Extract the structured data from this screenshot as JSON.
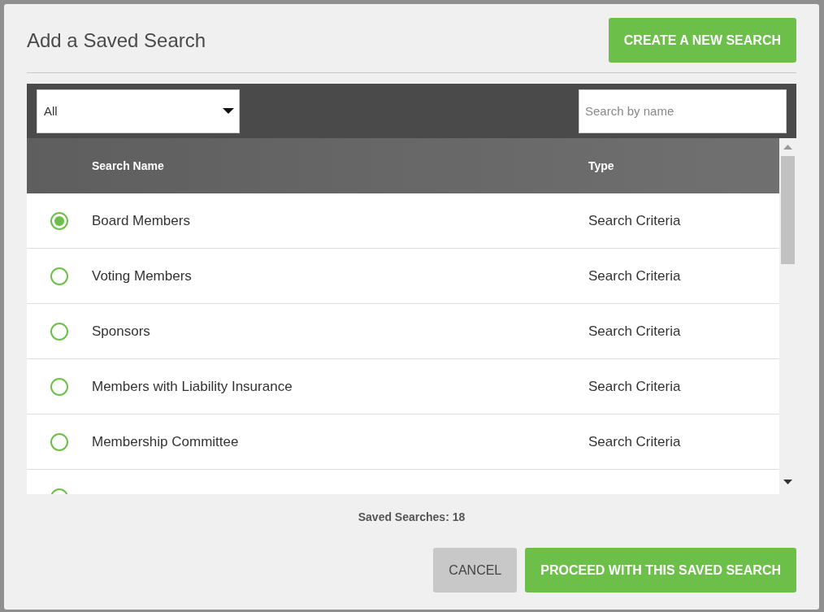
{
  "dialog": {
    "title": "Add a Saved Search",
    "create_button": "CREATE A NEW SEARCH"
  },
  "filter": {
    "value": "All"
  },
  "search": {
    "placeholder": "Search by name"
  },
  "table": {
    "columns": [
      "Search Name",
      "Type"
    ],
    "rows": [
      {
        "name": "Board Members",
        "type": "Search Criteria",
        "selected": true
      },
      {
        "name": "Voting Members",
        "type": "Search Criteria",
        "selected": false
      },
      {
        "name": "Sponsors",
        "type": "Search Criteria",
        "selected": false
      },
      {
        "name": "Members with Liability Insurance",
        "type": "Search Criteria",
        "selected": false
      },
      {
        "name": "Membership Committee",
        "type": "Search Criteria",
        "selected": false
      },
      {
        "selected": false
      }
    ]
  },
  "count": "Saved Searches: 18",
  "buttons": [
    {
      "label": "CANCEL",
      "kind": "secondary"
    },
    {
      "label": "PROCEED WITH THIS SAVED SEARCH",
      "kind": "primary"
    }
  ]
}
